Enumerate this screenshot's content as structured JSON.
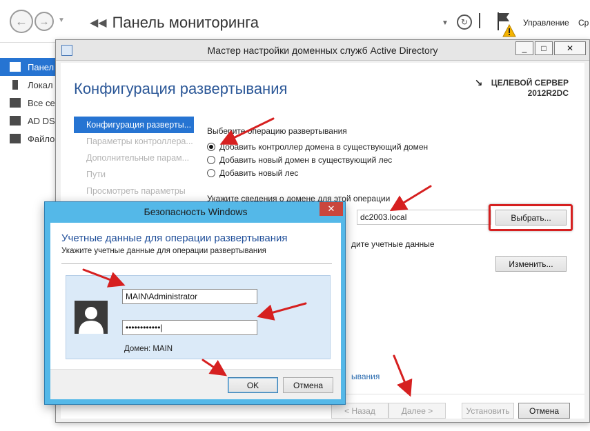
{
  "server_manager": {
    "title": "Панель мониторинга",
    "menu_manage": "Управление",
    "menu_tools": "Ср",
    "sidebar": [
      {
        "label": "Панел",
        "active": true
      },
      {
        "label": "Локал",
        "active": false
      },
      {
        "label": "Все се",
        "active": false
      },
      {
        "label": "AD DS",
        "active": false
      },
      {
        "label": "Файло",
        "active": false
      }
    ]
  },
  "wizard": {
    "title": "Мастер настройки доменных служб Active Directory",
    "heading": "Конфигурация развертывания",
    "target_label": "ЦЕЛЕВОЙ СЕРВЕР",
    "target_name": "2012R2DC",
    "nav": [
      "Конфигурация разверты...",
      "Параметры контроллера...",
      "Дополнительные парам...",
      "Пути",
      "Просмотреть параметры"
    ],
    "operation_label": "Выберите операцию развертывания",
    "options": [
      {
        "label": "Добавить контроллер домена в существующий домен",
        "selected": true
      },
      {
        "label": "Добавить новый домен в существующий лес",
        "selected": false
      },
      {
        "label": "Добавить новый лес",
        "selected": false
      }
    ],
    "domain_label": "Укажите сведения о домене для этой операции",
    "domain_value": "dc2003.local",
    "select_button": "Выбрать...",
    "creds_label": "дите учетные данные",
    "change_button": "Изменить...",
    "more_link": "ывания",
    "buttons": {
      "back": "< Назад",
      "next": "Далее >",
      "install": "Установить",
      "cancel": "Отмена"
    },
    "window_controls": {
      "minimize": "_",
      "maximize": "□",
      "close": "✕"
    }
  },
  "security_dialog": {
    "title": "Безопасность Windows",
    "close": "✕",
    "heading": "Учетные данные для операции развертывания",
    "subheading": "Укажите учетные данные для операции развертывания",
    "username": "MAIN\\Administrator",
    "password_mask": "••••••••••••|",
    "domain": "Домен: MAIN",
    "ok": "OK",
    "cancel": "Отмена"
  },
  "annotation_color": "#d62020"
}
